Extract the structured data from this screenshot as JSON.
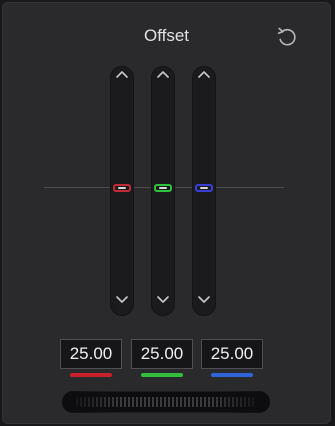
{
  "panel": {
    "title": "Offset",
    "reset_icon": "reset-icon"
  },
  "sliders": [
    {
      "channel": "red",
      "color": "#c02b35",
      "value": "25.00",
      "bar_color": "#c7222c"
    },
    {
      "channel": "green",
      "color": "#2fc33d",
      "value": "25.00",
      "bar_color": "#2fbf3a"
    },
    {
      "channel": "blue",
      "color": "#3a3fd6",
      "value": "25.00",
      "bar_color": "#2f63d8"
    }
  ],
  "icons": {
    "up": "chevron-up-icon",
    "down": "chevron-down-icon",
    "jog": "jog-wheel"
  }
}
